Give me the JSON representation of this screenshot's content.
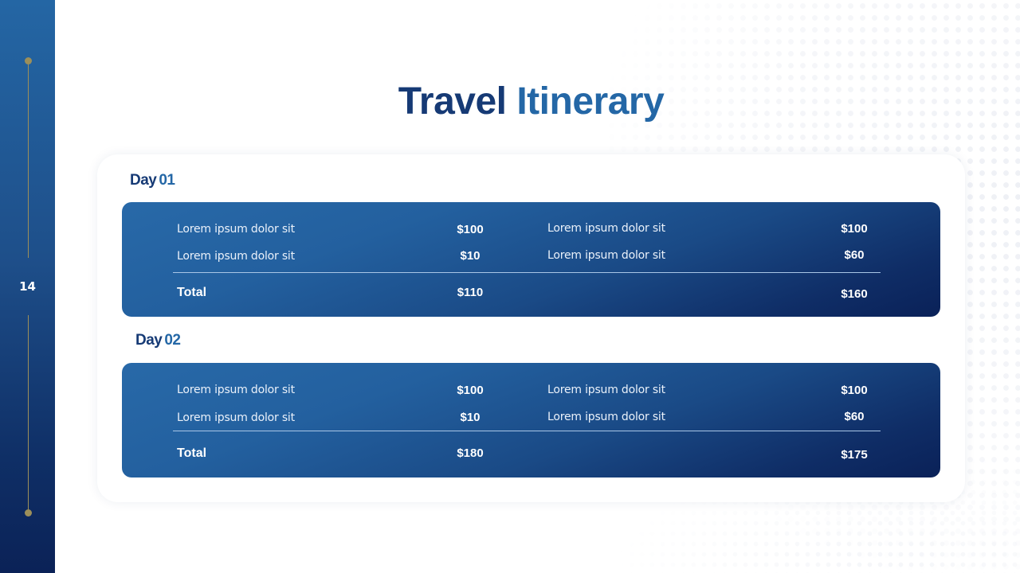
{
  "slide": {
    "page_number": "14",
    "title_part1": "Travel",
    "title_part2": "Itinerary"
  },
  "days": [
    {
      "label": "Day",
      "number": "01",
      "left": {
        "items": [
          {
            "name": "Lorem ipsum dolor sit",
            "amount": "$100"
          },
          {
            "name": "Lorem ipsum dolor sit",
            "amount": "$10"
          }
        ],
        "total_label": "Total",
        "total": "$110"
      },
      "right": {
        "items": [
          {
            "name": "Lorem ipsum dolor sit",
            "amount": "$100"
          },
          {
            "name": "Lorem ipsum dolor sit",
            "amount": "$60"
          }
        ],
        "total": "$160"
      }
    },
    {
      "label": "Day",
      "number": "02",
      "left": {
        "items": [
          {
            "name": "Lorem ipsum dolor sit",
            "amount": "$100"
          },
          {
            "name": "Lorem ipsum dolor sit",
            "amount": "$10"
          }
        ],
        "total_label": "Total",
        "total": "$180"
      },
      "right": {
        "items": [
          {
            "name": "Lorem ipsum dolor sit",
            "amount": "$100"
          },
          {
            "name": "Lorem ipsum dolor sit",
            "amount": "$60"
          }
        ],
        "total": "$175"
      }
    }
  ],
  "colors": {
    "title_dark": "#163a75",
    "title_accent": "#2467a6",
    "sidebar_top": "#2466a4",
    "sidebar_bottom": "#0b2257",
    "timeline_gold": "#9c8f5a"
  }
}
